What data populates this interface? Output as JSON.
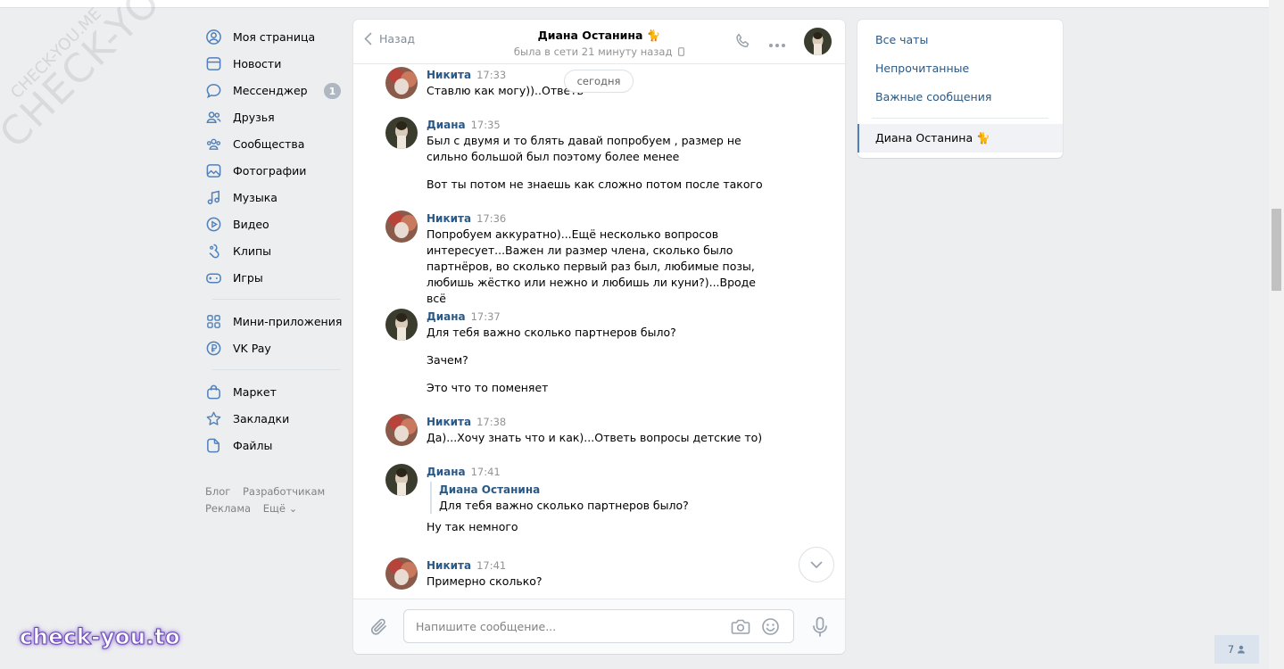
{
  "nav": {
    "items": [
      {
        "label": "Моя страница",
        "icon": "profile-icon"
      },
      {
        "label": "Новости",
        "icon": "news-icon"
      },
      {
        "label": "Мессенджер",
        "icon": "messenger-icon",
        "badge": "1"
      },
      {
        "label": "Друзья",
        "icon": "friends-icon"
      },
      {
        "label": "Сообщества",
        "icon": "communities-icon"
      },
      {
        "label": "Фотографии",
        "icon": "photos-icon"
      },
      {
        "label": "Музыка",
        "icon": "music-icon"
      },
      {
        "label": "Видео",
        "icon": "video-icon"
      },
      {
        "label": "Клипы",
        "icon": "clips-icon"
      },
      {
        "label": "Игры",
        "icon": "games-icon"
      }
    ],
    "items2": [
      {
        "label": "Мини-приложения",
        "icon": "mini-apps-icon"
      },
      {
        "label": "VK Pay",
        "icon": "vkpay-icon"
      }
    ],
    "items3": [
      {
        "label": "Маркет",
        "icon": "market-icon"
      },
      {
        "label": "Закладки",
        "icon": "bookmarks-icon"
      },
      {
        "label": "Файлы",
        "icon": "files-icon"
      }
    ],
    "footer": [
      "Блог",
      "Разработчикам",
      "Реклама",
      "Ещё ⌄"
    ]
  },
  "chat": {
    "back_label": "Назад",
    "peer_name": "Диана Останина 🐈",
    "peer_status": "была в сети 21 минуту назад",
    "date_pill": "сегодня",
    "messages": [
      {
        "author": "Никита",
        "time": "17:33",
        "lines": [
          "Ставлю как могу))..Ответь"
        ]
      },
      {
        "author": "Диана",
        "time": "17:35",
        "lines": [
          "Был с двумя и то блять давай попробуем , размер не сильно большой был поэтому более менее",
          "Вот ты потом не знаешь как сложно потом после такого"
        ]
      },
      {
        "author": "Никита",
        "time": "17:36",
        "lines": [
          "Попробуем аккуратно)...Ещё несколько вопросов интересует...Важен ли размер члена, сколько было партнёров, во сколько первый раз был, любимые позы, любишь жёстко или нежно и любишь ли куни?)...Вроде всё"
        ]
      },
      {
        "author": "Диана",
        "time": "17:37",
        "lines": [
          "Для тебя важно сколько партнеров было?",
          "Зачем?",
          "Это что то поменяет"
        ]
      },
      {
        "author": "Никита",
        "time": "17:38",
        "lines": [
          "Да)...Хочу знать что и как)...Ответь вопросы детские то)"
        ]
      },
      {
        "author": "Диана",
        "time": "17:41",
        "fwd_author": "Диана Останина",
        "fwd_text": "Для тебя важно сколько партнеров было?",
        "lines": [
          "Ну так немного"
        ]
      },
      {
        "author": "Никита",
        "time": "17:41",
        "lines": [
          "Примерно сколько?"
        ]
      }
    ],
    "composer_placeholder": "Напишите сообщение..."
  },
  "right_menu": {
    "all_chats": "Все чаты",
    "unread": "Непрочитанные",
    "important": "Важные сообщения",
    "active_chat": "Диана Останина 🐈"
  },
  "online_count": "7",
  "watermark": {
    "big": "CHECK-YOU.ME",
    "small": "CHECK-YOU.ME",
    "brand": "check-you.to"
  },
  "colors": {
    "link": "#2a5885",
    "background": "#edeef0",
    "accent": "#5181b8"
  }
}
